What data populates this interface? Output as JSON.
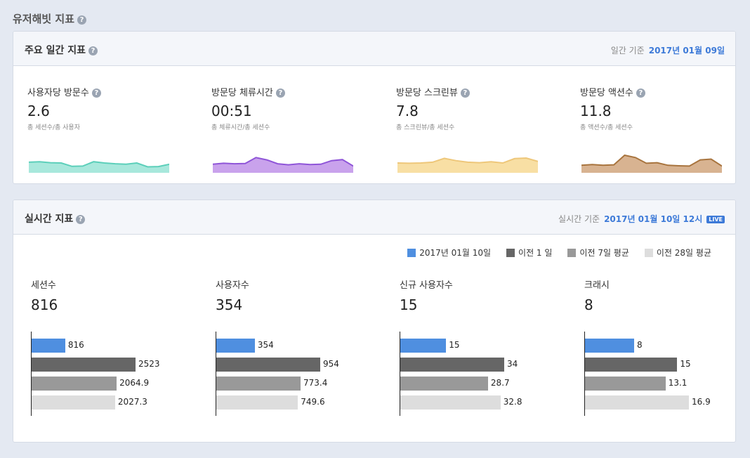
{
  "page_title": "유저해빗 지표",
  "daily": {
    "title": "주요 일간 지표",
    "basis_label": "일간 기준",
    "date": "2017년 01월 09일",
    "metrics": [
      {
        "label": "사용자당 방문수",
        "value": "2.6",
        "sub": "총 세션수/총 사용자",
        "color": "#5ccfba",
        "fill": "#a8e8dc",
        "trend": [
          0.55,
          0.58,
          0.52,
          0.5,
          0.28,
          0.3,
          0.58,
          0.5,
          0.45,
          0.42,
          0.5,
          0.25,
          0.27,
          0.42
        ]
      },
      {
        "label": "방문당 체류시간",
        "value": "00:51",
        "sub": "총 체류시간/총 세션수",
        "color": "#8f55d8",
        "fill": "#c9a2ec",
        "trend": [
          0.42,
          0.48,
          0.45,
          0.47,
          0.85,
          0.7,
          0.45,
          0.38,
          0.45,
          0.4,
          0.42,
          0.65,
          0.72,
          0.3
        ]
      },
      {
        "label": "방문당 스크린뷰",
        "value": "7.8",
        "sub": "총 스크린뷰/총 세션수",
        "color": "#eec77a",
        "fill": "#f8dfa4",
        "trend": [
          0.5,
          0.48,
          0.5,
          0.55,
          0.8,
          0.65,
          0.55,
          0.52,
          0.58,
          0.5,
          0.78,
          0.82,
          0.6
        ]
      },
      {
        "label": "방문당 액션수",
        "value": "11.8",
        "sub": "총 액션수/총 세션수",
        "color": "#a8743e",
        "fill": "#d8b391",
        "trend": [
          0.35,
          0.4,
          0.35,
          0.38,
          1.0,
          0.85,
          0.48,
          0.52,
          0.35,
          0.32,
          0.3,
          0.7,
          0.75,
          0.3
        ]
      }
    ]
  },
  "realtime": {
    "title": "실시간 지표",
    "basis_label": "실시간 기준",
    "date": "2017년 01월 10일 12시",
    "live_badge": "LIVE",
    "legend": [
      {
        "label": "2017년 01월 10일",
        "color": "#4f8fe0"
      },
      {
        "label": "이전 1 일",
        "color": "#666666"
      },
      {
        "label": "이전 7일 평균",
        "color": "#999999"
      },
      {
        "label": "이전 28일 평균",
        "color": "#dddddd"
      }
    ],
    "chart_data": [
      {
        "type": "bar",
        "title": "세션수",
        "headline": "816",
        "values": [
          816,
          2523,
          2064.9,
          2027.3
        ],
        "labels": [
          "816",
          "2523",
          "2064.9",
          "2027.3"
        ],
        "max": 2523
      },
      {
        "type": "bar",
        "title": "사용자수",
        "headline": "354",
        "values": [
          354,
          954,
          773.4,
          749.6
        ],
        "labels": [
          "354",
          "954",
          "773.4",
          "749.6"
        ],
        "max": 954
      },
      {
        "type": "bar",
        "title": "신규 사용자수",
        "headline": "15",
        "values": [
          15,
          34,
          28.7,
          32.8
        ],
        "labels": [
          "15",
          "34",
          "28.7",
          "32.8"
        ],
        "max": 34
      },
      {
        "type": "bar",
        "title": "크래시",
        "headline": "8",
        "values": [
          8,
          15,
          13.1,
          16.9
        ],
        "labels": [
          "8",
          "15",
          "13.1",
          "16.9"
        ],
        "max": 16.9
      }
    ]
  }
}
